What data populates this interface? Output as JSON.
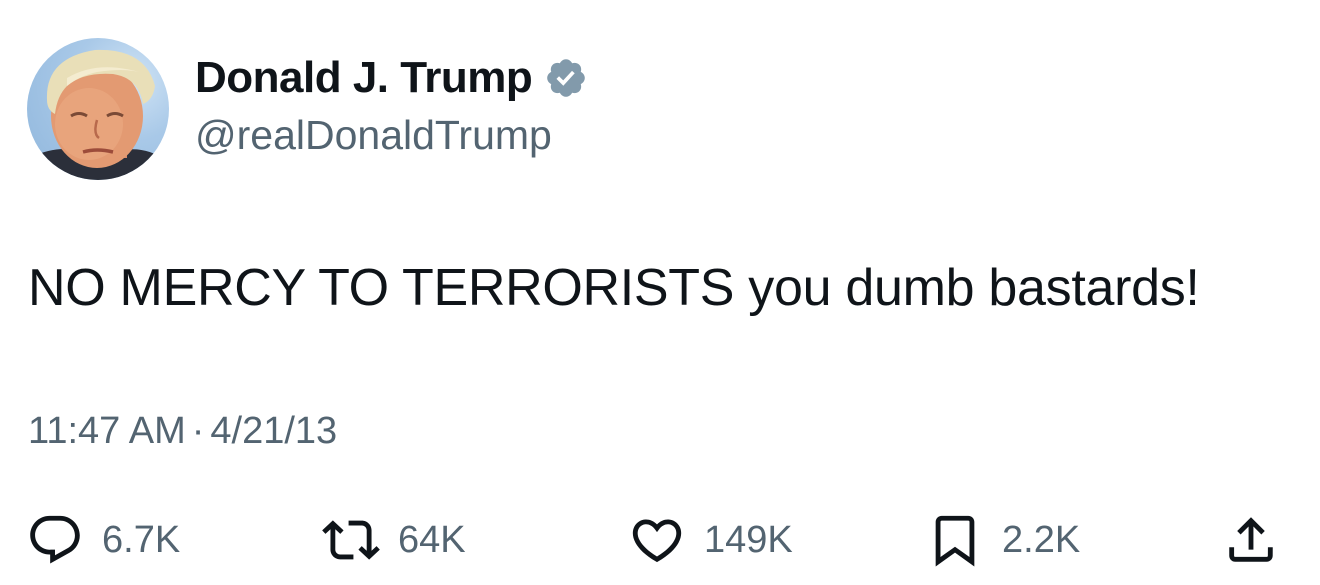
{
  "author": {
    "display_name": "Donald J. Trump",
    "handle": "@realDonaldTrump",
    "verified_icon": "verified-badge-icon",
    "avatar": "profile-photo"
  },
  "tweet": {
    "text": "NO MERCY TO TERRORISTS you dumb bastards!",
    "time": "11:47 AM",
    "separator": "·",
    "date": "4/21/13"
  },
  "actions": {
    "replies": "6.7K",
    "retweets": "64K",
    "likes": "149K",
    "bookmarks": "2.2K"
  },
  "colors": {
    "text_primary": "#0f1419",
    "text_secondary": "#536471",
    "verified_badge": "#829aab"
  }
}
